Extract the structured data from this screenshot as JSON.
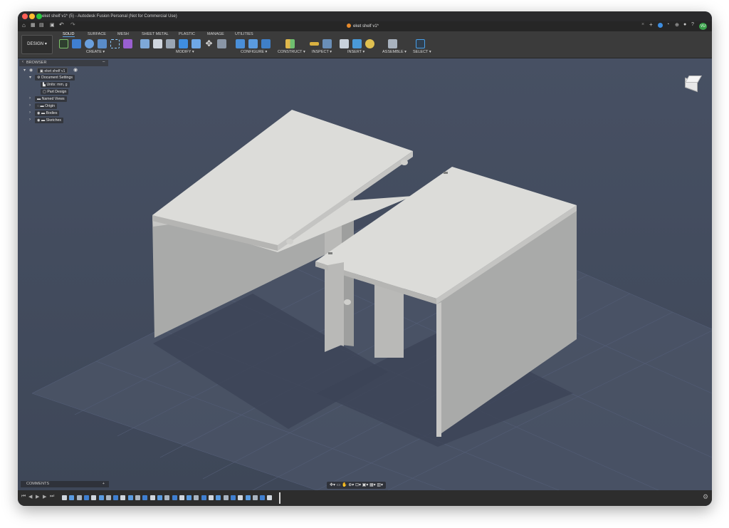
{
  "window": {
    "title": "eket shelf v1* (5) - Autodesk Fusion Personal (Not for Commercial Use)"
  },
  "doc_tab": {
    "title": "eket shelf v1*"
  },
  "user": {
    "initials": "VU"
  },
  "toolbar": {
    "workspace": "DESIGN",
    "tabs": [
      "SOLID",
      "SURFACE",
      "MESH",
      "SHEET METAL",
      "PLASTIC",
      "MANAGE",
      "UTILITIES"
    ],
    "groups": [
      "CREATE",
      "MODIFY",
      "CONFIGURE",
      "CONSTRUCT",
      "INSPECT",
      "INSERT",
      "ASSEMBLE",
      "SELECT"
    ]
  },
  "browser": {
    "header": "BROWSER",
    "root": "eket shelf v1",
    "items": [
      "Document Settings",
      "Units: mm, g",
      "Part Design",
      "Named Views",
      "Origin",
      "Bodies",
      "Sketches"
    ]
  },
  "comments": {
    "label": "COMMENTS"
  },
  "colors": {
    "viewport": "#475063",
    "accent": "#5aa0e0",
    "tab_dot": "#e78a2b",
    "avatar": "#3aa14a"
  }
}
